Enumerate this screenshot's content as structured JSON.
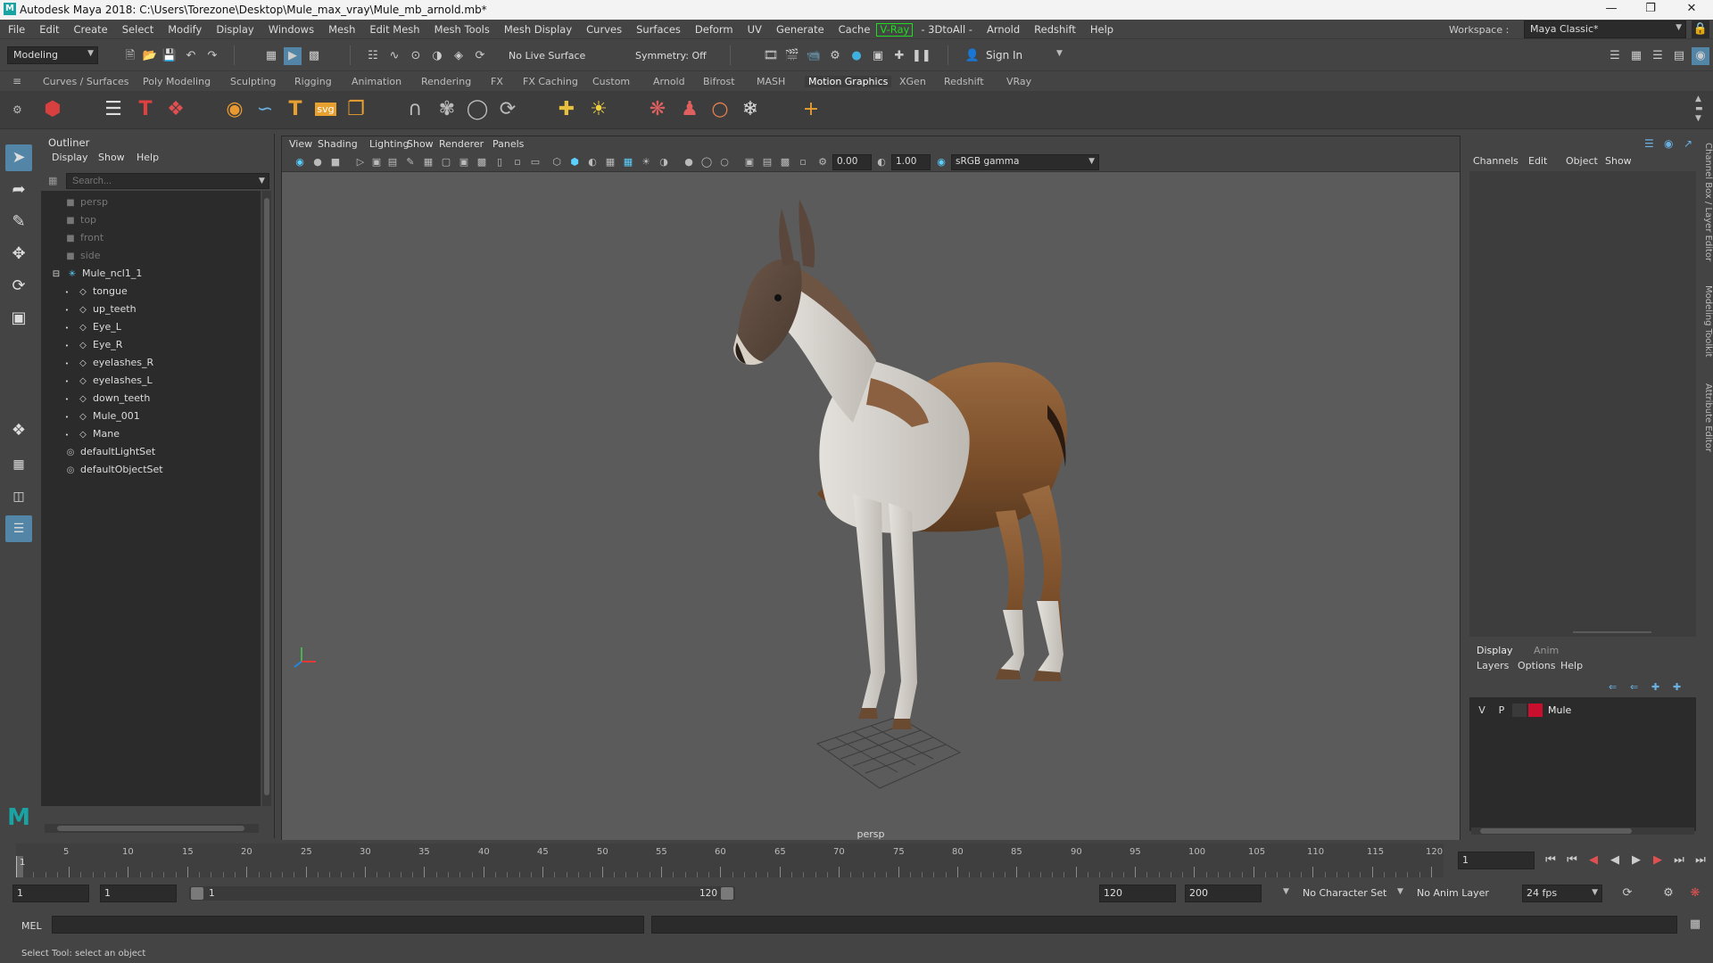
{
  "window": {
    "title": "Autodesk Maya 2018: C:\\Users\\Torezone\\Desktop\\Mule_max_vray\\Mule_mb_arnold.mb*"
  },
  "menubar": {
    "items": [
      "File",
      "Edit",
      "Create",
      "Select",
      "Modify",
      "Display",
      "Windows",
      "Mesh",
      "Edit Mesh",
      "Mesh Tools",
      "Mesh Display",
      "Curves",
      "Surfaces",
      "Deform",
      "UV",
      "Generate",
      "Cache"
    ],
    "vray": "V-Ray",
    "items2": [
      "- 3DtoAll -",
      "Arnold",
      "Redshift",
      "Help"
    ],
    "workspace_label": "Workspace :",
    "workspace_value": "Maya Classic*"
  },
  "statusline": {
    "mode": "Modeling",
    "live_surface": "No Live Surface",
    "symmetry": "Symmetry: Off",
    "sign_in": "Sign In"
  },
  "shelf": {
    "tabs": [
      "Curves / Surfaces",
      "Poly Modeling",
      "Sculpting",
      "Rigging",
      "Animation",
      "Rendering",
      "FX",
      "FX Caching",
      "Custom",
      "Arnold",
      "Bifrost",
      "MASH",
      "Motion Graphics",
      "XGen",
      "Redshift",
      "VRay"
    ],
    "active_tab": "Motion Graphics",
    "svg_label": "svg"
  },
  "outliner": {
    "title": "Outliner",
    "menu": [
      "Display",
      "Show",
      "Help"
    ],
    "search_placeholder": "Search...",
    "items": [
      {
        "label": "persp",
        "kind": "camera",
        "dim": true,
        "indent": 0
      },
      {
        "label": "top",
        "kind": "camera",
        "dim": true,
        "indent": 0
      },
      {
        "label": "front",
        "kind": "camera",
        "dim": true,
        "indent": 0
      },
      {
        "label": "side",
        "kind": "camera",
        "dim": true,
        "indent": 0
      },
      {
        "label": "Mule_ncl1_1",
        "kind": "group",
        "dim": false,
        "indent": 0
      },
      {
        "label": "tongue",
        "kind": "mesh",
        "dim": false,
        "indent": 1
      },
      {
        "label": "up_teeth",
        "kind": "mesh",
        "dim": false,
        "indent": 1
      },
      {
        "label": "Eye_L",
        "kind": "mesh",
        "dim": false,
        "indent": 1
      },
      {
        "label": "Eye_R",
        "kind": "mesh",
        "dim": false,
        "indent": 1
      },
      {
        "label": "eyelashes_R",
        "kind": "mesh",
        "dim": false,
        "indent": 1
      },
      {
        "label": "eyelashes_L",
        "kind": "mesh",
        "dim": false,
        "indent": 1
      },
      {
        "label": "down_teeth",
        "kind": "mesh",
        "dim": false,
        "indent": 1
      },
      {
        "label": "Mule_001",
        "kind": "mesh",
        "dim": false,
        "indent": 1
      },
      {
        "label": "Mane",
        "kind": "mesh",
        "dim": false,
        "indent": 1
      },
      {
        "label": "defaultLightSet",
        "kind": "set",
        "dim": false,
        "indent": 0
      },
      {
        "label": "defaultObjectSet",
        "kind": "set",
        "dim": false,
        "indent": 0
      }
    ]
  },
  "viewport": {
    "menu": [
      "View",
      "Shading",
      "Lighting",
      "Show",
      "Renderer",
      "Panels"
    ],
    "exposure": "0.00",
    "gamma": "1.00",
    "color_space": "sRGB gamma",
    "camera": "persp"
  },
  "channelbox": {
    "menu": [
      "Channels",
      "Edit",
      "Object",
      "Show"
    ],
    "layer_tabs": [
      "Display",
      "Anim"
    ],
    "layer_menu": [
      "Layers",
      "Options",
      "Help"
    ],
    "layer": {
      "v": "V",
      "p": "P",
      "name": "Mule",
      "color": "#c8102e"
    },
    "side_tabs": [
      "Channel Box / Layer Editor",
      "Modeling Toolkit",
      "Attribute Editor"
    ]
  },
  "timeslider": {
    "ticks": [
      "5",
      "10",
      "15",
      "20",
      "25",
      "30",
      "35",
      "40",
      "45",
      "50",
      "55",
      "60",
      "65",
      "70",
      "75",
      "80",
      "85",
      "90",
      "95",
      "100",
      "105",
      "110",
      "115",
      "120"
    ],
    "current_frame_marker": "1",
    "current_frame": "1"
  },
  "rangeslider": {
    "start": "1",
    "playback_start": "1",
    "range_start_label": "1",
    "range_end_label": "120",
    "playback_end": "120",
    "end": "200",
    "character_set": "No Character Set",
    "anim_layer": "No Anim Layer",
    "fps": "24 fps"
  },
  "cmdline": {
    "label": "MEL"
  },
  "helpline": {
    "text": "Select Tool: select an object"
  },
  "colors": {
    "accent": "#5285a6",
    "bg": "#444444",
    "field": "#2b2b2b",
    "viewport": "#5b5b5b",
    "vray": "#1fdc1f"
  }
}
